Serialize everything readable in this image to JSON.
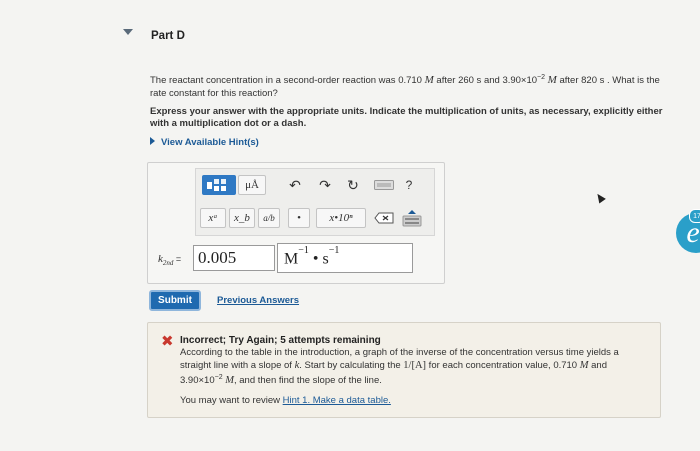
{
  "part": {
    "title": "Part D"
  },
  "question": {
    "text_1": "The reactant concentration in a second-order reaction was 0.710 ",
    "unit_m_1": "M",
    "text_2": " after 260 s and 3.90×10",
    "exp_1": "−2",
    "unit_m_2": "M",
    "text_3": " after 820 s . What is the rate constant for this reaction?"
  },
  "instructions": "Express your answer with the appropriate units. Indicate the multiplication of units, as necessary, explicitly either with a multiplication dot or a dash.",
  "hints": {
    "label": "View Available Hint(s)"
  },
  "toolbar": {
    "mu_label": "μÅ",
    "undo_glyph": "↶",
    "redo_glyph": "↷",
    "reset_glyph": "↻",
    "help_label": "?",
    "superscript_label": "xᵃ",
    "subscript_label": "x_b",
    "fraction_label": "a/b",
    "dot_label": "•",
    "sci_label": "x•10ⁿ"
  },
  "answer": {
    "var_label": "k",
    "var_sub": "2nd",
    "equals": " =",
    "value": "0.005",
    "unit_base_1": "M",
    "unit_exp_1": "−1",
    "unit_dot": " • ",
    "unit_base_2": "s",
    "unit_exp_2": "−1"
  },
  "buttons": {
    "submit": "Submit",
    "previous_answers": "Previous Answers"
  },
  "feedback": {
    "title": "Incorrect; Try Again; 5 attempts remaining",
    "b1": "According to the table in the introduction, a graph of the inverse of the concentration versus time yields a straight line with a slope of ",
    "k": "k",
    "b2": ". Start by calculating the ",
    "inv": "1/[A]",
    "b3": " for each concentration value, 0.710 ",
    "m1": "M",
    "b4": " and 3.90×10",
    "exp": "−2",
    "m2": "M",
    "b5": ", and then find the slope of the line.",
    "review_prefix": "You may want to review ",
    "review_link": "Hint 1. Make a data table."
  },
  "side_badge": {
    "count": "17",
    "glyph": "e"
  },
  "colors": {
    "link": "#1c5a96",
    "submit": "#1f6ab0",
    "error": "#c8382e",
    "badge": "#2a9fc9"
  }
}
